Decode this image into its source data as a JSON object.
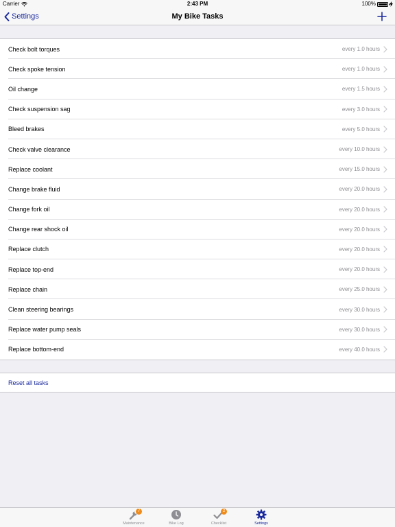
{
  "status_bar": {
    "carrier": "Carrier",
    "time": "2:43 PM",
    "battery": "100%"
  },
  "nav": {
    "back_label": "Settings",
    "title": "My Bike Tasks",
    "add_icon": "plus-icon"
  },
  "tasks": [
    {
      "name": "Check bolt torques",
      "interval": "every 1.0 hours"
    },
    {
      "name": "Check spoke tension",
      "interval": "every 1.0 hours"
    },
    {
      "name": "Oil change",
      "interval": "every 1.5 hours"
    },
    {
      "name": "Check suspension sag",
      "interval": "every 3.0 hours"
    },
    {
      "name": "Bleed brakes",
      "interval": "every 5.0 hours"
    },
    {
      "name": "Check valve clearance",
      "interval": "every 10.0 hours"
    },
    {
      "name": "Replace coolant",
      "interval": "every 15.0 hours"
    },
    {
      "name": "Change brake fluid",
      "interval": "every 20.0 hours"
    },
    {
      "name": "Change fork oil",
      "interval": "every 20.0 hours"
    },
    {
      "name": "Change rear shock oil",
      "interval": "every 20.0 hours"
    },
    {
      "name": "Replace clutch",
      "interval": "every 20.0 hours"
    },
    {
      "name": "Replace top-end",
      "interval": "every 20.0 hours"
    },
    {
      "name": "Replace chain",
      "interval": "every 25.0 hours"
    },
    {
      "name": "Clean steering bearings",
      "interval": "every 30.0 hours"
    },
    {
      "name": "Replace water pump seals",
      "interval": "every 30.0 hours"
    },
    {
      "name": "Replace bottom-end",
      "interval": "every 40.0 hours"
    }
  ],
  "reset": {
    "label": "Reset all tasks"
  },
  "tab_bar": {
    "tabs": [
      {
        "label": "Maintenance",
        "icon": "wrench-icon",
        "badge": "7"
      },
      {
        "label": "Bike Log",
        "icon": "clock-icon",
        "badge": ""
      },
      {
        "label": "Checklist",
        "icon": "checkmark-icon",
        "badge": "2"
      },
      {
        "label": "Settings",
        "icon": "gear-icon",
        "badge": ""
      }
    ],
    "active_tab": "Settings"
  },
  "colors": {
    "accent": "#1a2a9e",
    "badge": "#f08c1c",
    "secondary_text": "#8e8e93",
    "background": "#efeff4"
  }
}
